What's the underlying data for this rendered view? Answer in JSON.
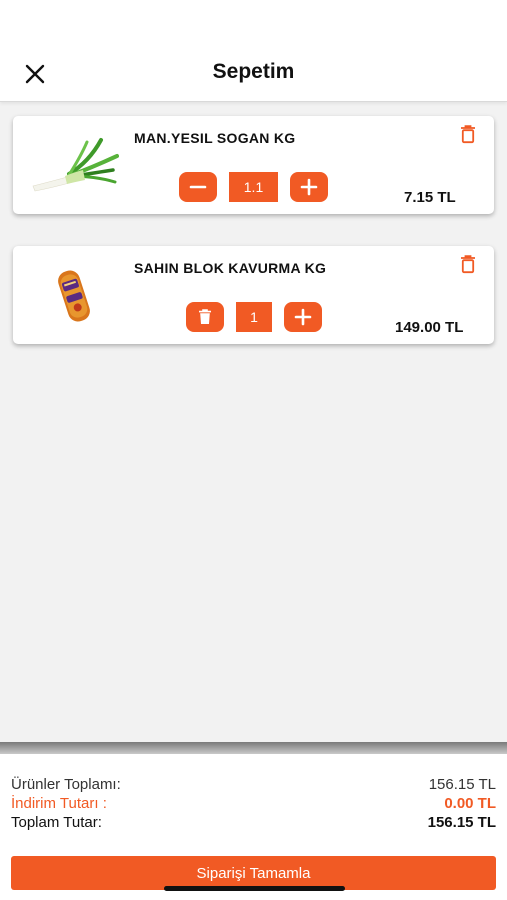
{
  "header": {
    "title": "Sepetim",
    "close_icon": "close-icon"
  },
  "cart": {
    "items": [
      {
        "name": "MAN.YESIL SOGAN KG",
        "quantity": "1.1",
        "price": "7.15 TL",
        "image_icon": "green-onion-image",
        "left_button_icon": "minus-icon"
      },
      {
        "name": "SAHIN BLOK KAVURMA KG",
        "quantity": "1",
        "price": "149.00 TL",
        "image_icon": "kavurma-package-image",
        "left_button_icon": "trash-icon"
      }
    ]
  },
  "summary": {
    "products_total_label": "Ürünler Toplamı:",
    "products_total_value": "156.15 TL",
    "discount_label": "İndirim Tutarı :",
    "discount_value": "0.00 TL",
    "grand_total_label": "Toplam Tutar:",
    "grand_total_value": "156.15 TL"
  },
  "actions": {
    "complete_order_label": "Siparişi Tamamla"
  },
  "colors": {
    "accent": "#f15a24",
    "background": "#f2f2f2",
    "card": "#ffffff"
  }
}
